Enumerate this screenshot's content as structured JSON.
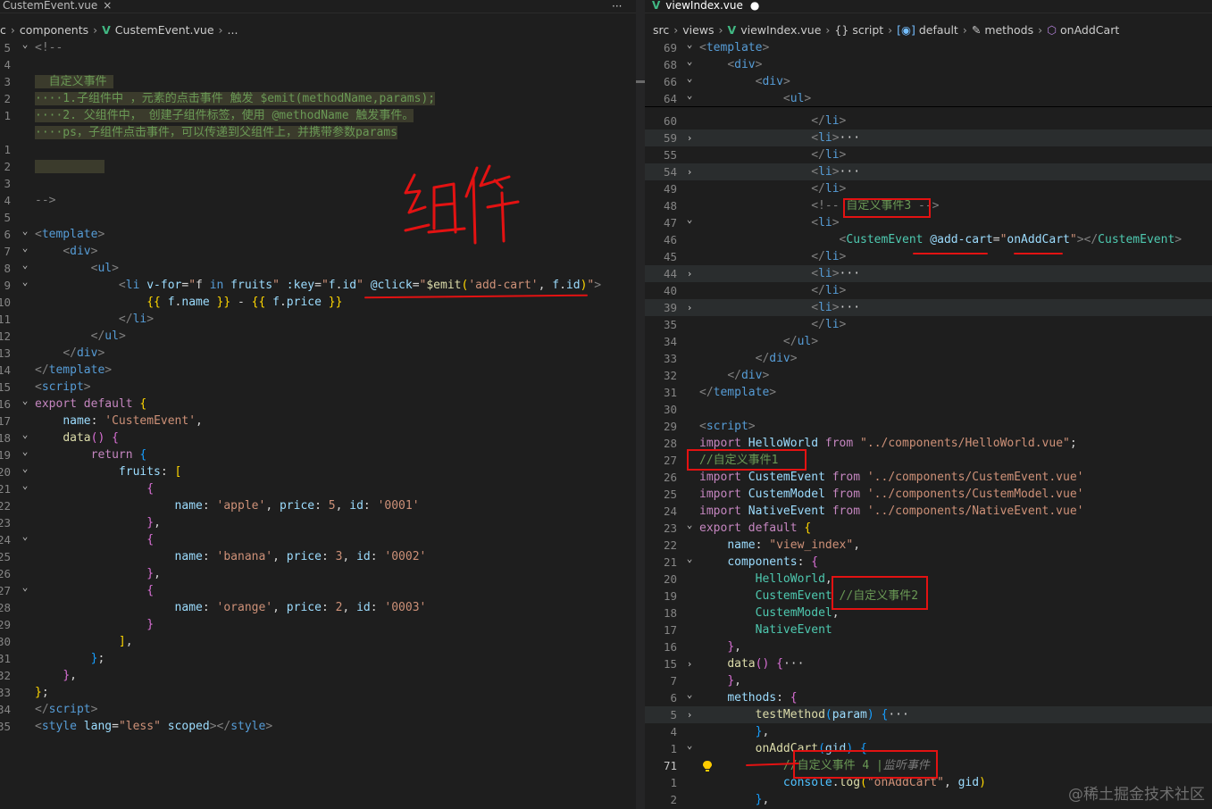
{
  "left": {
    "tab_title": "CustemEvent.vue",
    "tab_close": "×",
    "more": "···",
    "breadcrumb": {
      "start": "c",
      "components": "components",
      "file": "CustemEvent.vue",
      "tail": "..."
    },
    "lines": [
      {
        "n": "5",
        "fold": "v",
        "html": "<span class='tag'>&lt;!--</span>"
      },
      {
        "n": "4",
        "fold": "",
        "html": ""
      },
      {
        "n": "3",
        "fold": "",
        "bulb": true,
        "html": "<span class='cm chl'>  自定义事件 </span>"
      },
      {
        "n": "2",
        "fold": "",
        "html": "<span class='cm chl'>····1.子组件中 ，元素的点击事件 触发 $emit(methodName,params);</span>"
      },
      {
        "n": "1",
        "fold": "",
        "html": "<span class='cm chl'>····2. 父组件中， 创建子组件标签，使用 @methodName 触发事件。</span>"
      },
      {
        "n": "",
        "fold": "",
        "html": "<span class='cm chl'>····ps，子组件点击事件，可以传递到父组件上，并携带参数params</span>"
      },
      {
        "n": "1",
        "fold": "",
        "html": ""
      },
      {
        "n": "2",
        "fold": "",
        "html": "<span class='chl'>          </span>"
      },
      {
        "n": "3",
        "fold": "",
        "html": ""
      },
      {
        "n": "4",
        "fold": "",
        "html": "<span class='tag'>--&gt;</span>"
      },
      {
        "n": "5",
        "fold": "",
        "html": ""
      },
      {
        "n": "6",
        "fold": "v",
        "html": "<span class='tag'>&lt;</span><span class='tn'>template</span><span class='tag'>&gt;</span>"
      },
      {
        "n": "7",
        "fold": "v",
        "html": "    <span class='tag'>&lt;</span><span class='tn'>div</span><span class='tag'>&gt;</span>"
      },
      {
        "n": "8",
        "fold": "v",
        "html": "        <span class='tag'>&lt;</span><span class='tn'>ul</span><span class='tag'>&gt;</span>"
      },
      {
        "n": "9",
        "fold": "v",
        "html": "            <span class='tag'>&lt;</span><span class='tn'>li</span> <span class='at'>v-for</span><span class='pl'>=</span><span class='st'>\"</span><span class='pl'>f</span> <span class='dk'>in</span> <span class='at'>fruits</span><span class='st'>\"</span> <span class='at'>:key</span><span class='pl'>=</span><span class='st'>\"</span><span class='at'>f</span>.<span class='at'>id</span><span class='st'>\"</span> <span class='at'>@click</span><span class='pl'>=</span><span class='st'>\"</span><span class='fn'>$emit</span><span class='br'>(</span><span class='st'>'add-cart'</span>, <span class='at'>f</span>.<span class='at'>id</span><span class='br'>)</span><span class='st'>\"</span><span class='tag'>&gt;</span>"
      },
      {
        "n": "10",
        "fold": "",
        "html": "                <span class='br'>{{</span> <span class='at'>f</span>.<span class='at'>name</span> <span class='br'>}}</span> - <span class='br'>{{</span> <span class='at'>f</span>.<span class='at'>price</span> <span class='br'>}}</span>"
      },
      {
        "n": "11",
        "fold": "",
        "html": "            <span class='tag'>&lt;/</span><span class='tn'>li</span><span class='tag'>&gt;</span>"
      },
      {
        "n": "12",
        "fold": "",
        "html": "        <span class='tag'>&lt;/</span><span class='tn'>ul</span><span class='tag'>&gt;</span>"
      },
      {
        "n": "13",
        "fold": "",
        "html": "    <span class='tag'>&lt;/</span><span class='tn'>div</span><span class='tag'>&gt;</span>"
      },
      {
        "n": "14",
        "fold": "",
        "html": "<span class='tag'>&lt;/</span><span class='tn'>template</span><span class='tag'>&gt;</span>"
      },
      {
        "n": "15",
        "fold": "",
        "html": "<span class='tag'>&lt;</span><span class='tn'>script</span><span class='tag'>&gt;</span>"
      },
      {
        "n": "16",
        "fold": "v",
        "html": "<span class='kw'>export</span> <span class='kw'>default</span> <span class='br'>{</span>"
      },
      {
        "n": "17",
        "fold": "",
        "html": "    <span class='at'>name</span>: <span class='st'>'CustemEvent'</span>,"
      },
      {
        "n": "18",
        "fold": "v",
        "html": "    <span class='fn'>data</span><span class='bp'>()</span> <span class='bp'>{</span>"
      },
      {
        "n": "19",
        "fold": "v",
        "html": "        <span class='kw'>return</span> <span class='bb'>{</span>"
      },
      {
        "n": "20",
        "fold": "v",
        "html": "            <span class='at'>fruits</span>: <span class='br'>[</span>"
      },
      {
        "n": "21",
        "fold": "v",
        "html": "                <span class='bp'>{</span>"
      },
      {
        "n": "22",
        "fold": "",
        "html": "                    <span class='at'>name</span>: <span class='st'>'apple'</span>, <span class='at'>price</span>: <span class='st'>5</span>, <span class='at'>id</span>: <span class='st'>'0001'</span>"
      },
      {
        "n": "23",
        "fold": "",
        "html": "                <span class='bp'>}</span>,"
      },
      {
        "n": "24",
        "fold": "v",
        "html": "                <span class='bp'>{</span>"
      },
      {
        "n": "25",
        "fold": "",
        "html": "                    <span class='at'>name</span>: <span class='st'>'banana'</span>, <span class='at'>price</span>: <span class='st'>3</span>, <span class='at'>id</span>: <span class='st'>'0002'</span>"
      },
      {
        "n": "26",
        "fold": "",
        "html": "                <span class='bp'>}</span>,"
      },
      {
        "n": "27",
        "fold": "v",
        "html": "                <span class='bp'>{</span>"
      },
      {
        "n": "28",
        "fold": "",
        "html": "                    <span class='at'>name</span>: <span class='st'>'orange'</span>, <span class='at'>price</span>: <span class='st'>2</span>, <span class='at'>id</span>: <span class='st'>'0003'</span>"
      },
      {
        "n": "29",
        "fold": "",
        "html": "                <span class='bp'>}</span>"
      },
      {
        "n": "30",
        "fold": "",
        "html": "            <span class='br'>]</span>,"
      },
      {
        "n": "31",
        "fold": "",
        "html": "        <span class='bb'>}</span>;"
      },
      {
        "n": "32",
        "fold": "",
        "html": "    <span class='bp'>}</span>,"
      },
      {
        "n": "33",
        "fold": "",
        "html": "<span class='br'>}</span>;"
      },
      {
        "n": "34",
        "fold": "",
        "html": "<span class='tag'>&lt;/</span><span class='tn'>script</span><span class='tag'>&gt;</span>"
      },
      {
        "n": "35",
        "fold": "",
        "html": "<span class='tag'>&lt;</span><span class='tn'>style</span> <span class='at'>lang</span>=<span class='st'>\"less\"</span> <span class='at'>scoped</span><span class='tag'>&gt;&lt;/</span><span class='tn'>style</span><span class='tag'>&gt;</span>"
      }
    ]
  },
  "right": {
    "tab_title": "viewIndex.vue",
    "breadcrumb": {
      "src": "src",
      "views": "views",
      "file": "viewIndex.vue",
      "script": "script",
      "default": "default",
      "methods": "methods",
      "fn": "onAddCart"
    },
    "sticky": [
      {
        "n": "69",
        "fold": "v",
        "html": "<span class='tag'>&lt;</span><span class='tn'>template</span><span class='tag'>&gt;</span>"
      },
      {
        "n": "68",
        "fold": "v",
        "html": "    <span class='tag'>&lt;</span><span class='tn'>div</span><span class='tag'>&gt;</span>"
      },
      {
        "n": "66",
        "fold": "v",
        "html": "        <span class='tag'>&lt;</span><span class='tn'>div</span><span class='tag'>&gt;</span>"
      },
      {
        "n": "64",
        "fold": "v",
        "html": "            <span class='tag'>&lt;</span><span class='tn'>ul</span><span class='tag'>&gt;</span>"
      }
    ],
    "lines": [
      {
        "n": "60",
        "fold": "",
        "html": "                <span class='tag'>&lt;/</span><span class='tn'>li</span><span class='tag'>&gt;</span>"
      },
      {
        "n": "59",
        "fold": ">",
        "hl": true,
        "html": "                <span class='tag'>&lt;</span><span class='tn'>li</span><span class='tag'>&gt;</span><span class='pl'>···</span>"
      },
      {
        "n": "55",
        "fold": "",
        "html": "                <span class='tag'>&lt;/</span><span class='tn'>li</span><span class='tag'>&gt;</span>"
      },
      {
        "n": "54",
        "fold": ">",
        "hl": true,
        "html": "                <span class='tag'>&lt;</span><span class='tn'>li</span><span class='tag'>&gt;</span><span class='pl'>···</span>"
      },
      {
        "n": "49",
        "fold": "",
        "html": "                <span class='tag'>&lt;/</span><span class='tn'>li</span><span class='tag'>&gt;</span>"
      },
      {
        "n": "48",
        "fold": "",
        "html": "                <span class='tag'>&lt;!--</span> <span class='cm'>自定义事件3</span> <span class='tag'>--&gt;</span>"
      },
      {
        "n": "47",
        "fold": "v",
        "html": "                <span class='tag'>&lt;</span><span class='tn'>li</span><span class='tag'>&gt;</span>"
      },
      {
        "n": "46",
        "fold": "",
        "html": "                    <span class='tag'>&lt;</span><span class='cmp'>CustemEvent</span> <span class='at'>@add-cart</span>=<span class='st'>\"</span><span class='at'>onAddCart</span><span class='st'>\"</span><span class='tag'>&gt;&lt;/</span><span class='cmp'>CustemEvent</span><span class='tag'>&gt;</span>"
      },
      {
        "n": "45",
        "fold": "",
        "html": "                <span class='tag'>&lt;/</span><span class='tn'>li</span><span class='tag'>&gt;</span>"
      },
      {
        "n": "44",
        "fold": ">",
        "hl": true,
        "html": "                <span class='tag'>&lt;</span><span class='tn'>li</span><span class='tag'>&gt;</span><span class='pl'>···</span>"
      },
      {
        "n": "40",
        "fold": "",
        "html": "                <span class='tag'>&lt;/</span><span class='tn'>li</span><span class='tag'>&gt;</span>"
      },
      {
        "n": "39",
        "fold": ">",
        "hl": true,
        "html": "                <span class='tag'>&lt;</span><span class='tn'>li</span><span class='tag'>&gt;</span><span class='pl'>···</span>"
      },
      {
        "n": "35",
        "fold": "",
        "html": "                <span class='tag'>&lt;/</span><span class='tn'>li</span><span class='tag'>&gt;</span>"
      },
      {
        "n": "34",
        "fold": "",
        "html": "            <span class='tag'>&lt;/</span><span class='tn'>ul</span><span class='tag'>&gt;</span>"
      },
      {
        "n": "33",
        "fold": "",
        "html": "        <span class='tag'>&lt;/</span><span class='tn'>div</span><span class='tag'>&gt;</span>"
      },
      {
        "n": "32",
        "fold": "",
        "html": "    <span class='tag'>&lt;/</span><span class='tn'>div</span><span class='tag'>&gt;</span>"
      },
      {
        "n": "31",
        "fold": "",
        "html": "<span class='tag'>&lt;/</span><span class='tn'>template</span><span class='tag'>&gt;</span>"
      },
      {
        "n": "30",
        "fold": "",
        "html": ""
      },
      {
        "n": "29",
        "fold": "",
        "html": "<span class='tag'>&lt;</span><span class='tn'>script</span><span class='tag'>&gt;</span>"
      },
      {
        "n": "28",
        "fold": "",
        "html": "<span class='kw'>import</span> <span class='at'>HelloWorld</span> <span class='kw'>from</span> <span class='st'>\"../components/HelloWorld.vue\"</span>;"
      },
      {
        "n": "27",
        "fold": "",
        "html": "<span class='cm'>//自定义事件1</span>"
      },
      {
        "n": "26",
        "fold": "",
        "html": "<span class='kw'>import</span> <span class='at'>CustemEvent</span> <span class='kw'>from</span> <span class='st'>'../components/CustemEvent.vue'</span>"
      },
      {
        "n": "25",
        "fold": "",
        "html": "<span class='kw'>import</span> <span class='at'>CustemModel</span> <span class='kw'>from</span> <span class='st'>'../components/CustemModel.vue'</span>"
      },
      {
        "n": "24",
        "fold": "",
        "html": "<span class='kw'>import</span> <span class='at'>NativeEvent</span> <span class='kw'>from</span> <span class='st'>'../components/NativeEvent.vue'</span>"
      },
      {
        "n": "23",
        "fold": "v",
        "html": "<span class='kw'>export</span> <span class='kw'>default</span> <span class='br'>{</span>"
      },
      {
        "n": "22",
        "fold": "",
        "html": "    <span class='at'>name</span>: <span class='st'>\"view_index\"</span>,"
      },
      {
        "n": "21",
        "fold": "v",
        "html": "    <span class='at'>components</span>: <span class='bp'>{</span>"
      },
      {
        "n": "20",
        "fold": "",
        "html": "        <span class='cmp'>HelloWorld</span>,"
      },
      {
        "n": "19",
        "fold": "",
        "html": "        <span class='cmp'>CustemEvent</span> <span class='cm'>//自定义事件2</span>"
      },
      {
        "n": "18",
        "fold": "",
        "html": "        <span class='cmp'>CustemModel</span>,"
      },
      {
        "n": "17",
        "fold": "",
        "html": "        <span class='cmp'>NativeEvent</span>"
      },
      {
        "n": "16",
        "fold": "",
        "html": "    <span class='bp'>}</span>,"
      },
      {
        "n": "15",
        "fold": ">",
        "html": "    <span class='fn'>data</span><span class='bp'>()</span> <span class='bp'>{</span><span class='pl'>···</span>"
      },
      {
        "n": "7",
        "fold": "",
        "html": "    <span class='bp'>}</span>,"
      },
      {
        "n": "6",
        "fold": "v",
        "html": "    <span class='at'>methods</span>: <span class='bp'>{</span>"
      },
      {
        "n": "5",
        "fold": ">",
        "hl": true,
        "html": "        <span class='fn'>testMethod</span><span class='bb'>(</span><span class='at'>param</span><span class='bb'>)</span> <span class='bb'>{</span><span class='pl'>···</span>"
      },
      {
        "n": "4",
        "fold": "",
        "html": "        <span class='bb'>}</span>,"
      },
      {
        "n": "1",
        "fold": "v",
        "html": "        <span class='fn'>onAddCart</span><span class='bb'>(</span><span class='at'>gid</span><span class='bb'>)</span> <span class='bb'>{</span>"
      },
      {
        "n": "71",
        "fold": "",
        "cur": true,
        "bulb": true,
        "html": "            <span class='cm'>//自定义事件 4 |</span><span class='cm' style='font-style:italic;color:#7a7a7a'>监听事件</span>"
      },
      {
        "n": "1",
        "fold": "",
        "html": "            <span class='ob'>console</span>.<span class='fn'>log</span><span class='br'>(</span><span class='st'>\"onAddCart\"</span>, <span class='at'>gid</span><span class='br'>)</span>"
      },
      {
        "n": "2",
        "fold": "",
        "html": "        <span class='bb'>}</span>,"
      }
    ]
  },
  "handwriting": "组件",
  "watermark": "@稀土掘金技术社区"
}
